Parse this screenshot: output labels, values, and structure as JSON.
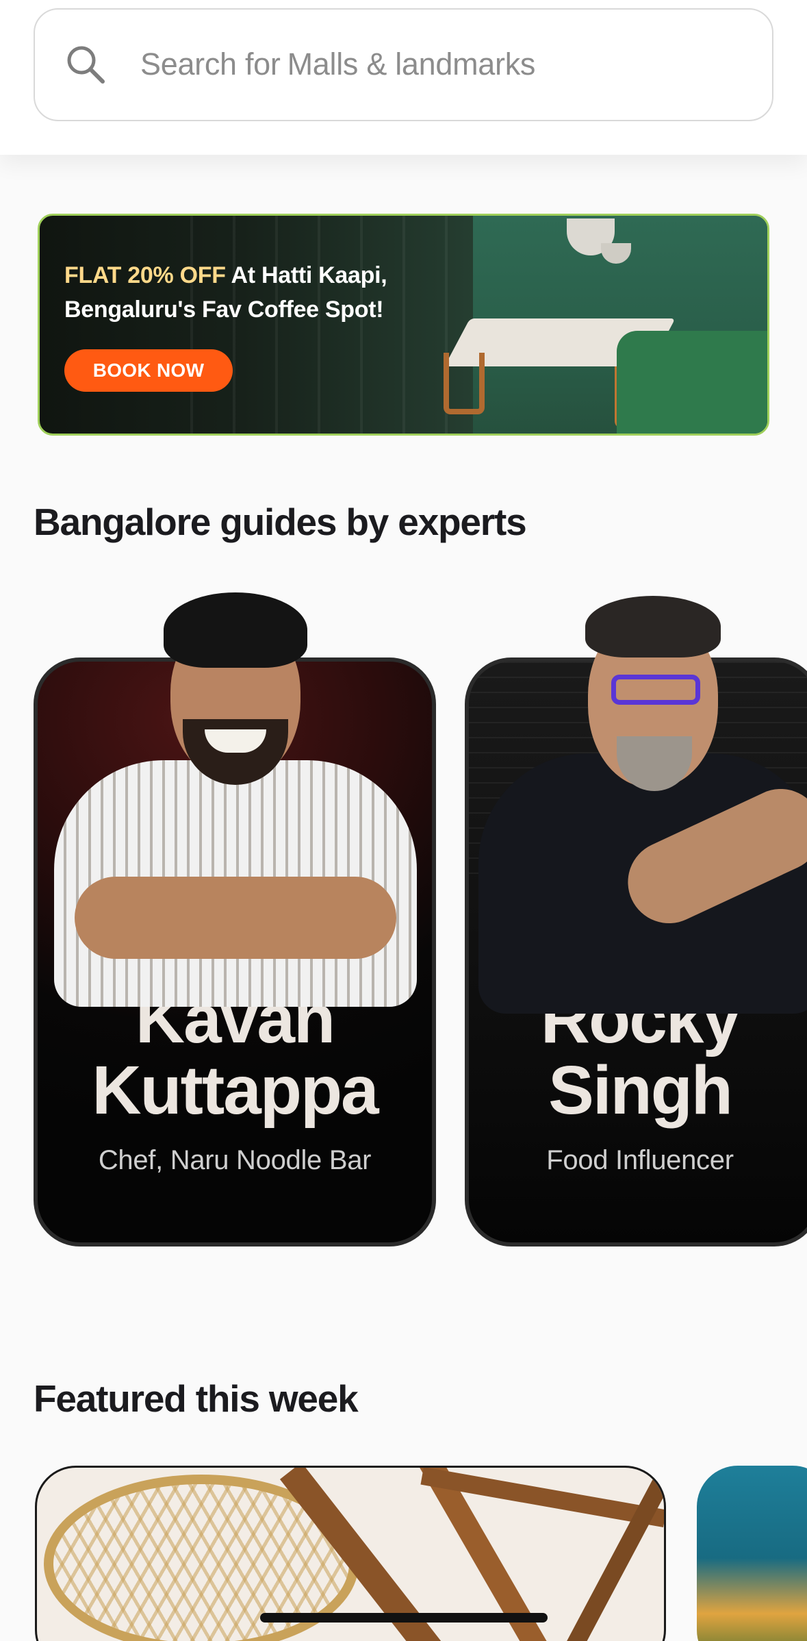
{
  "search": {
    "prefix": "Search for",
    "term": "Malls & landmarks"
  },
  "banner": {
    "headline_accent": "FLAT 20% OFF",
    "headline_rest": " At Hatti Kaapi,",
    "headline_line2": "Bengaluru's Fav Coffee Spot!",
    "cta_label": "BOOK NOW",
    "cta_color": "#ff5a12"
  },
  "guides": {
    "title": "Bangalore guides by experts",
    "items": [
      {
        "first_name": "Kavan",
        "last_name": "Kuttappa",
        "role": "Chef, Naru Noodle Bar"
      },
      {
        "first_name": "Rocky",
        "last_name": "Singh",
        "role": "Food Influencer"
      }
    ]
  },
  "featured": {
    "title": "Featured this week"
  }
}
